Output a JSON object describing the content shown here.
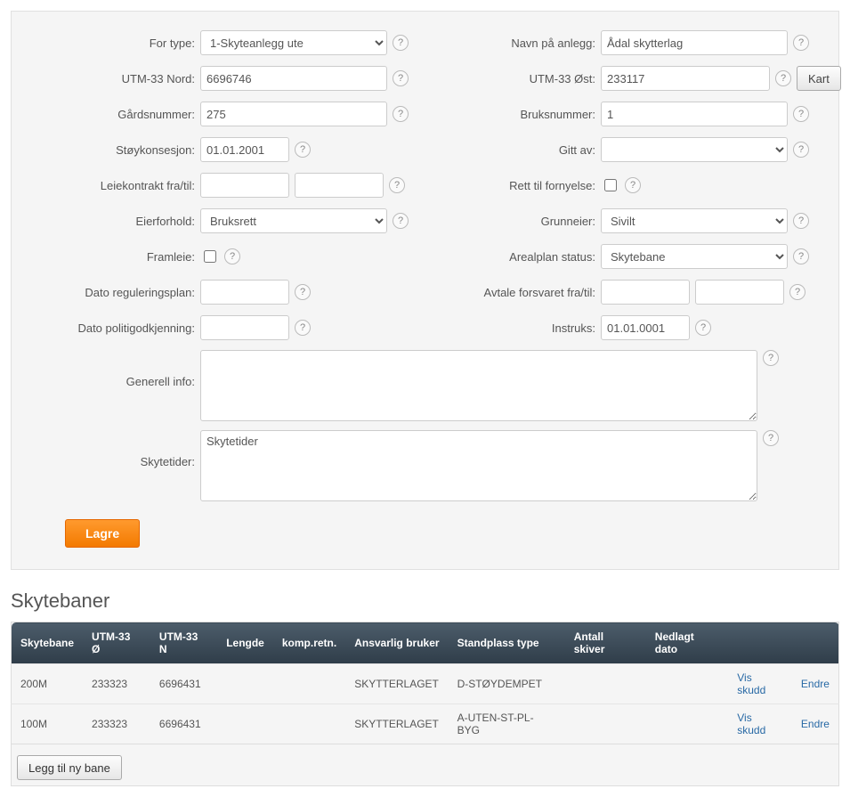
{
  "labels": {
    "for_type": "For type:",
    "navn": "Navn på anlegg:",
    "utm_n": "UTM-33 Nord:",
    "utm_o": "UTM-33 Øst:",
    "gards": "Gårdsnummer:",
    "bruks": "Bruksnummer:",
    "stoy": "Støykonsesjon:",
    "gitt_av": "Gitt av:",
    "leie": "Leiekontrakt fra/til:",
    "rett": "Rett til fornyelse:",
    "eier": "Eierforhold:",
    "grunn": "Grunneier:",
    "framleie": "Framleie:",
    "areal": "Arealplan status:",
    "dato_reg": "Dato reguleringsplan:",
    "avtale": "Avtale forsvaret fra/til:",
    "dato_pol": "Dato politigodkjenning:",
    "instruks": "Instruks:",
    "gen_info": "Generell info:",
    "skytetider": "Skytetider:"
  },
  "form": {
    "for_type": "1-Skyteanlegg ute",
    "navn": "Ådal skytterlag",
    "utm_n": "6696746",
    "utm_o": "233117",
    "gards": "275",
    "bruks": "1",
    "stoy": "01.01.2001",
    "gitt_av": "",
    "leie_fra": "",
    "leie_til": "",
    "rett": false,
    "eier": "Bruksrett",
    "grunn": "Sivilt",
    "framleie": false,
    "areal": "Skytebane",
    "dato_reg": "",
    "avtale_fra": "",
    "avtale_til": "",
    "dato_pol": "",
    "instruks": "01.01.0001",
    "gen_info": "",
    "skytetider": "Skytetider"
  },
  "buttons": {
    "kart": "Kart",
    "lagre": "Lagre",
    "legg_til": "Legg til ny bane",
    "vis_skudd": "Vis skudd",
    "endre": "Endre"
  },
  "section_title": "Skytebaner",
  "table": {
    "headers": [
      "Skytebane",
      "UTM-33 Ø",
      "UTM-33 N",
      "Lengde",
      "komp.retn.",
      "Ansvarlig bruker",
      "Standplass type",
      "Antall skiver",
      "Nedlagt dato"
    ],
    "rows": [
      {
        "cols": [
          "200M",
          "233323",
          "6696431",
          "",
          "",
          "SKYTTERLAGET",
          "D-STØYDEMPET",
          "",
          ""
        ]
      },
      {
        "cols": [
          "100M",
          "233323",
          "6696431",
          "",
          "",
          "SKYTTERLAGET",
          "A-UTEN-ST-PL-BYG",
          "",
          ""
        ]
      }
    ]
  }
}
